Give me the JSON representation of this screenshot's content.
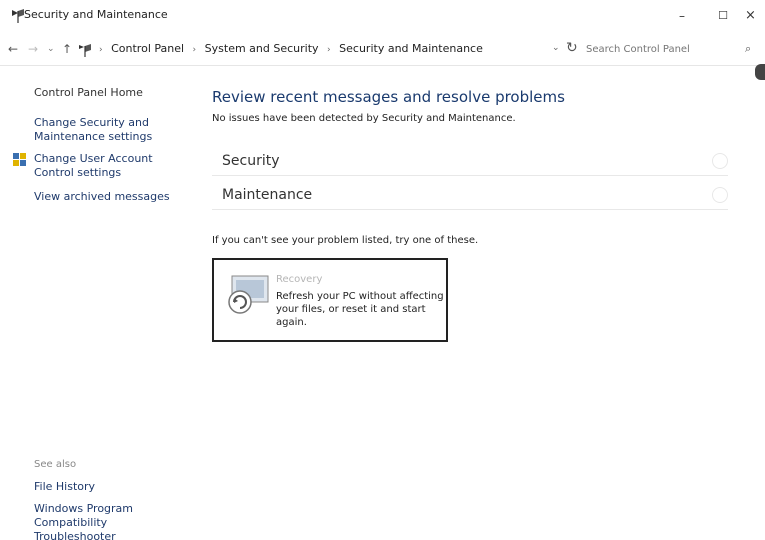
{
  "window": {
    "title": "Security and Maintenance",
    "controls": {
      "minimize": "–",
      "maximize": "☐",
      "close": "×"
    }
  },
  "address": {
    "nav": {
      "back": "←",
      "forward": "→",
      "recent": "⌄",
      "up": "↑"
    },
    "breadcrumb": [
      "Control Panel",
      "System and Security",
      "Security and Maintenance"
    ],
    "separator": "›",
    "dropdown": "⌄",
    "refresh": "↻",
    "search_placeholder": "Search Control Panel",
    "search_icon": "⌕"
  },
  "sidebar": {
    "items": [
      {
        "label": "Control Panel Home"
      },
      {
        "label": "Change Security and Maintenance settings"
      },
      {
        "label": "Change User Account Control settings",
        "icon": "shield-icon"
      },
      {
        "label": "View archived messages"
      }
    ],
    "see_also_heading": "See also",
    "see_also": [
      {
        "label": "File History"
      },
      {
        "label": "Windows Program Compatibility Troubleshooter"
      }
    ]
  },
  "main": {
    "title": "Review recent messages and resolve problems",
    "status": "No issues have been detected by Security and Maintenance.",
    "sections": [
      {
        "label": "Security"
      },
      {
        "label": "Maintenance"
      }
    ],
    "hint": "If you can't see your problem listed, try one of these.",
    "recovery": {
      "title": "Recovery",
      "description": "Refresh your PC without affecting your files, or reset it and start again.",
      "icon": "recovery-icon"
    }
  },
  "colors": {
    "link": "#1f3a6b",
    "title": "#1a3a6e",
    "border": "#e8e8e8"
  }
}
